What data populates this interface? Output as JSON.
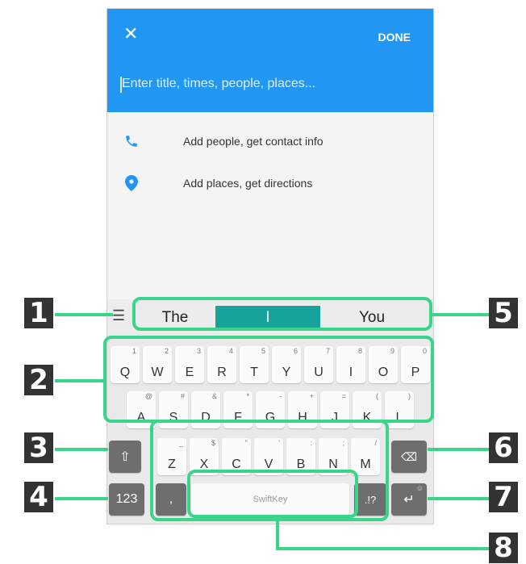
{
  "appbar": {
    "close_icon": "close-icon",
    "done_label": "DONE",
    "title_placeholder": "Enter title, times, people, places..."
  },
  "content": {
    "people": {
      "icon": "phone-icon",
      "label": "Add people, get contact info"
    },
    "places": {
      "icon": "location-pin-icon",
      "label": "Add places, get directions"
    }
  },
  "keyboard": {
    "suggestions": [
      "The",
      "I",
      "You"
    ],
    "row1": [
      {
        "k": "Q",
        "s": "1"
      },
      {
        "k": "W",
        "s": "2"
      },
      {
        "k": "E",
        "s": "3"
      },
      {
        "k": "R",
        "s": "4"
      },
      {
        "k": "T",
        "s": "5"
      },
      {
        "k": "Y",
        "s": "6"
      },
      {
        "k": "U",
        "s": "7"
      },
      {
        "k": "I",
        "s": "8"
      },
      {
        "k": "O",
        "s": "9"
      },
      {
        "k": "P",
        "s": "0"
      }
    ],
    "row2": [
      {
        "k": "A",
        "s": "@"
      },
      {
        "k": "S",
        "s": "#"
      },
      {
        "k": "D",
        "s": "&"
      },
      {
        "k": "F",
        "s": "*"
      },
      {
        "k": "G",
        "s": "-"
      },
      {
        "k": "H",
        "s": "+"
      },
      {
        "k": "J",
        "s": "="
      },
      {
        "k": "K",
        "s": "("
      },
      {
        "k": "L",
        "s": ")"
      }
    ],
    "row3": [
      {
        "k": "Z",
        "s": "_"
      },
      {
        "k": "X",
        "s": "$"
      },
      {
        "k": "C",
        "s": "\""
      },
      {
        "k": "V",
        "s": "'"
      },
      {
        "k": "B",
        "s": ":"
      },
      {
        "k": "N",
        "s": ";"
      },
      {
        "k": "M",
        "s": "/"
      }
    ],
    "num_label": "123",
    "comma_label": ",",
    "space_label": "SwiftKey",
    "punct_label": ".!?",
    "enter_sub": "☺"
  },
  "callouts": [
    "1",
    "2",
    "3",
    "4",
    "5",
    "6",
    "7",
    "8"
  ],
  "colors": {
    "appbar": "#2196f3",
    "highlight": "#3ad48a",
    "suggestion_active": "#16a39c"
  }
}
